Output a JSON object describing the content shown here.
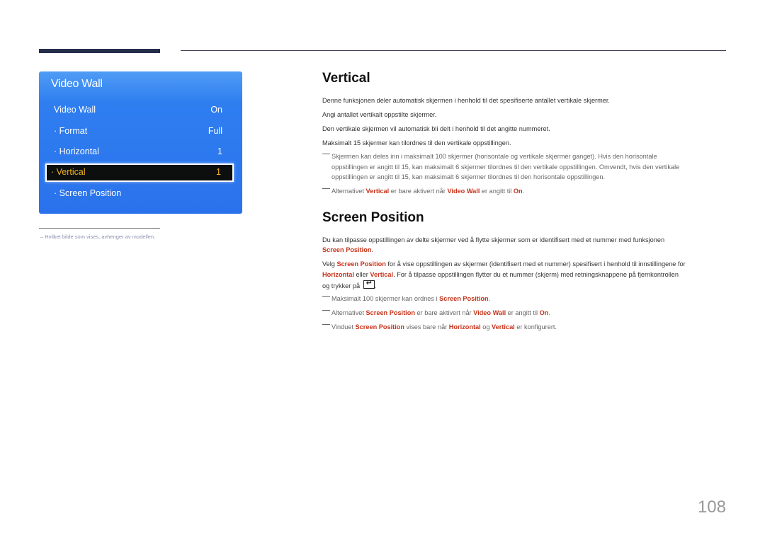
{
  "menu": {
    "title": "Video Wall",
    "items": [
      {
        "label": "Video Wall",
        "value": "On"
      },
      {
        "label": "· Format",
        "value": "Full"
      },
      {
        "label": "· Horizontal",
        "value": "1"
      },
      {
        "label": "· Vertical",
        "value": "1",
        "selected": true
      },
      {
        "label": "· Screen Position",
        "value": ""
      }
    ]
  },
  "footnote": "Hvilket bilde som vises, avhenger av modellen.",
  "vertical": {
    "heading": "Vertical",
    "paragraphs": [
      "Denne funksjonen deler automatisk skjermen i henhold til det spesifiserte antallet vertikale skjermer.",
      "Angi antallet vertikalt oppstilte skjermer.",
      "Den vertikale skjermen vil automatisk bli delt i henhold til det angitte nummeret.",
      "Maksimalt 15 skjermer kan tilordnes til den vertikale oppstillingen."
    ],
    "note1": {
      "line1": "Skjermen kan deles inn i maksimalt 100 skjermer (horisontale og vertikale skjermer ganget). Hvis den horisontale",
      "line2": "oppstillingen er angitt til 15, kan maksimalt 6 skjermer tilordnes til den vertikale oppstillingen. Omvendt, hvis den vertikale",
      "line3": "oppstillingen er angitt til 15, kan maksimalt 6 skjermer tilordnes til den horisontale oppstillingen."
    },
    "note2": {
      "t1": "Alternativet ",
      "h1": "Vertical",
      "t2": " er bare aktivert når ",
      "h2": "Video Wall",
      "t3": " er angitt til ",
      "h3": "On",
      "t4": "."
    }
  },
  "screen_position": {
    "heading": "Screen Position",
    "p1": {
      "t1": "Du kan tilpasse oppstillingen av delte skjermer ved å flytte skjermer som er identifisert med et nummer med funksjonen",
      "h1": "Screen Position",
      "t2": "."
    },
    "p2": {
      "t1": "Velg ",
      "h1": "Screen Position",
      "t2": " for å vise oppstillingen av skjermer (identifisert med et nummer) spesifisert i henhold til innstillingene for",
      "h2": "Horizontal",
      "t3": " eller ",
      "h3": "Vertical",
      "t4": ". For å tilpasse oppstillingen flytter du et nummer (skjerm) med retningsknappene på fjernkontrollen",
      "t5": "og trykker på ",
      "icon": "enter-icon",
      "t6": "."
    },
    "note1": {
      "t1": "Maksimalt 100 skjermer kan ordnes i ",
      "h1": "Screen Position",
      "t2": "."
    },
    "note2": {
      "t1": "Alternativet ",
      "h1": "Screen Position",
      "t2": " er bare aktivert når ",
      "h2": "Video Wall",
      "t3": " er angitt til ",
      "h3": "On",
      "t4": "."
    },
    "note3": {
      "t1": "Vinduet ",
      "h1": "Screen Position",
      "t2": " vises bare når ",
      "h2": "Horizontal",
      "t3": " og ",
      "h3": "Vertical",
      "t4": " er konfigurert."
    }
  },
  "page_number": "108"
}
